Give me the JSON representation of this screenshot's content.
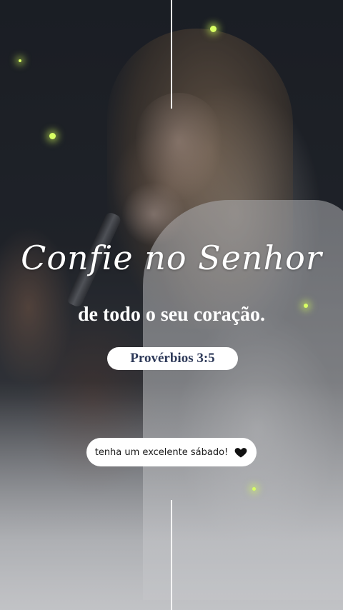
{
  "verse": {
    "title": "Confie no Senhor",
    "line": "de todo o seu coração.",
    "reference": "Provérbios 3:5"
  },
  "message": {
    "text": "tenha um excelente sábado!",
    "icon": "heart-icon"
  },
  "colors": {
    "accent_text": "#2e3a59",
    "bokeh": "#d8ff63",
    "pill_bg": "#ffffff"
  }
}
